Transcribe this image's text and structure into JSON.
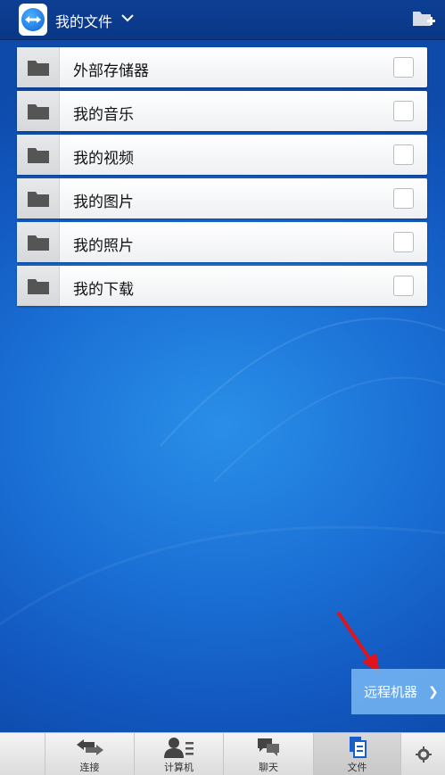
{
  "header": {
    "title": "我的文件"
  },
  "folders": [
    {
      "label": "外部存储器"
    },
    {
      "label": "我的音乐"
    },
    {
      "label": "我的视频"
    },
    {
      "label": "我的图片"
    },
    {
      "label": "我的照片"
    },
    {
      "label": "我的下载"
    }
  ],
  "remote_button": {
    "label": "远程机器",
    "arrow": "❯"
  },
  "tabs": [
    {
      "label": "连接",
      "icon": "arrows-icon"
    },
    {
      "label": "计算机",
      "icon": "contacts-icon"
    },
    {
      "label": "聊天",
      "icon": "chat-icon"
    },
    {
      "label": "文件",
      "icon": "files-icon",
      "active": true
    }
  ],
  "colors": {
    "header_bg": "#0a3786",
    "background": "#1a6fd4",
    "annotation_arrow": "#e0141c"
  }
}
